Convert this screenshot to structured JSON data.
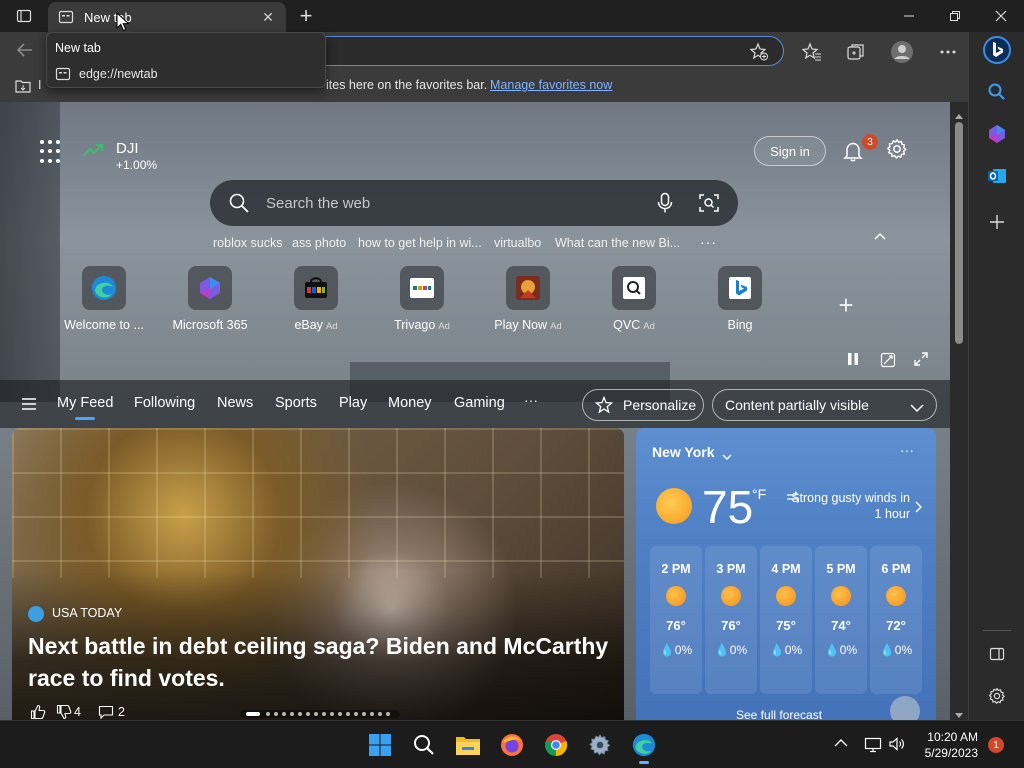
{
  "browser": {
    "tab": {
      "title": "New tab"
    },
    "tooltip": {
      "title": "New tab",
      "url": "edge://newtab"
    },
    "favorites_bar": {
      "prefix": "I",
      "message": "ites here on the favorites bar.",
      "link": "Manage favorites now"
    }
  },
  "newtab": {
    "stock": {
      "symbol": "DJI",
      "change": "+1.00%"
    },
    "sign_in": "Sign in",
    "notifications_count": "3",
    "search": {
      "placeholder": "Search the web"
    },
    "trending": [
      "roblox sucks",
      "ass photo",
      "how to get help in wi...",
      "virtualbo",
      "What can the new Bi..."
    ],
    "trending_more": "···",
    "tiles": [
      {
        "label": "Welcome to ...",
        "ad": "",
        "icon": "edge-icon"
      },
      {
        "label": "Microsoft 365",
        "ad": "",
        "icon": "microsoft365-icon"
      },
      {
        "label": "eBay",
        "ad": "Ad",
        "icon": "ebay-icon"
      },
      {
        "label": "Trivago",
        "ad": "Ad",
        "icon": "trivago-icon"
      },
      {
        "label": "Play Now",
        "ad": "Ad",
        "icon": "game-icon"
      },
      {
        "label": "QVC",
        "ad": "Ad",
        "icon": "qvc-icon"
      },
      {
        "label": "Bing",
        "ad": "",
        "icon": "bing-icon"
      }
    ],
    "feed_nav": {
      "tabs": [
        "My Feed",
        "Following",
        "News",
        "Sports",
        "Play",
        "Money",
        "Gaming"
      ],
      "more": "···",
      "personalize": "Personalize",
      "content_visibility": "Content partially visible"
    },
    "hero": {
      "source": "USA TODAY",
      "headline": "Next battle in debt ceiling saga? Biden and McCarthy race to find votes.",
      "dislikes": "4",
      "comments": "2"
    },
    "weather": {
      "city": "New York",
      "more": "···",
      "temp": "75",
      "unit": "°F",
      "alert": "Strong gusty winds in 1 hour",
      "hours": [
        {
          "time": "2 PM",
          "temp": "76°",
          "precip": "0%"
        },
        {
          "time": "3 PM",
          "temp": "76°",
          "precip": "0%"
        },
        {
          "time": "4 PM",
          "temp": "75°",
          "precip": "0%"
        },
        {
          "time": "5 PM",
          "temp": "74°",
          "precip": "0%"
        },
        {
          "time": "6 PM",
          "temp": "72°",
          "precip": "0%"
        }
      ],
      "forecast_link": "See full forecast"
    }
  },
  "taskbar": {
    "time": "10:20 AM",
    "date": "5/29/2023",
    "notification_count": "1"
  },
  "colors": {
    "accent": "#4fa3ff",
    "badge": "#d04a2a",
    "link": "#7fb3ff"
  }
}
